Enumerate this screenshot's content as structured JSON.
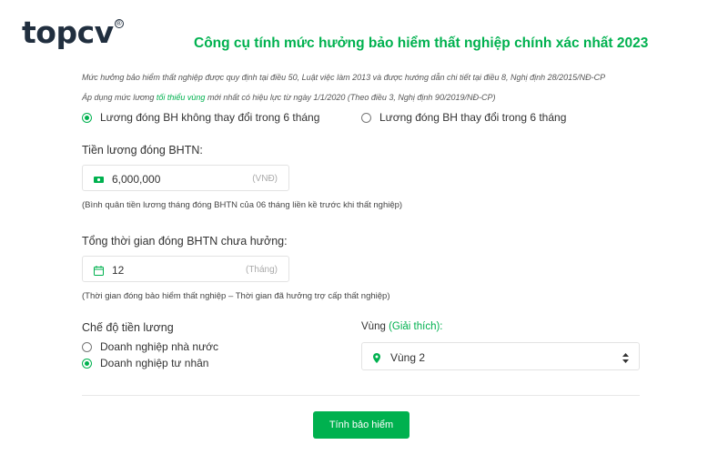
{
  "brand": {
    "logo_text": "topcv",
    "logo_mark": "®",
    "accent": "#00b14f",
    "logo_color": "#212f3f"
  },
  "title": "Công cụ tính mức hưởng bảo hiểm thất nghiệp chính xác nhất 2023",
  "notes": {
    "line1": "Mức hưởng bảo hiểm thất nghiệp được quy định tại điều 50, Luật việc làm 2013 và được hướng dẫn chi tiết tại điều 8, Nghị định 28/2015/NĐ-CP",
    "line2_prefix": "Áp dụng mức lương ",
    "line2_highlight": "tối thiểu vùng",
    "line2_suffix": " mới nhất có hiệu lực từ ngày 1/1/2020 (Theo điều 3, Nghị định 90/2019/NĐ-CP)"
  },
  "salary_mode": {
    "options": [
      {
        "label": "Lương đóng BH không thay đổi trong 6 tháng",
        "checked": true
      },
      {
        "label": "Lương đóng BH thay đổi trong 6 tháng",
        "checked": false
      }
    ]
  },
  "salary": {
    "label": "Tiền lương đóng BHTN:",
    "value": "6,000,000",
    "unit": "(VNĐ)",
    "icon": "money-icon",
    "hint": "(Bình quân tiền lương tháng đóng BHTN của 06 tháng liền kề trước khi thất nghiệp)"
  },
  "duration": {
    "label": "Tổng thời gian đóng BHTN chưa hưởng:",
    "value": "12",
    "unit": "(Tháng)",
    "icon": "calendar-icon",
    "hint": "(Thời gian đóng bảo hiểm thất nghiệp – Thời gian đã hưởng trợ cấp thất nghiệp)"
  },
  "regime": {
    "label": "Chế độ tiền lương",
    "options": [
      {
        "label": "Doanh nghiệp nhà nước",
        "checked": false
      },
      {
        "label": "Doanh nghiệp tư nhân",
        "checked": true
      }
    ]
  },
  "region": {
    "label": "Vùng",
    "explain": "(Giải thích):",
    "selected": "Vùng 2",
    "icon": "map-pin-icon"
  },
  "submit_label": "Tính bảo hiểm"
}
